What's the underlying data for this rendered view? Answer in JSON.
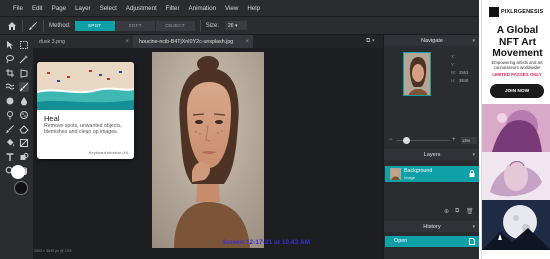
{
  "menubar": {
    "items": [
      "File",
      "Edit",
      "Page",
      "Layer",
      "Select",
      "Adjustment",
      "Filter",
      "Animation",
      "View",
      "Help"
    ]
  },
  "options": {
    "method_label": "Method:",
    "methods": [
      "SPOT",
      "SOFT",
      "OBJECT"
    ],
    "active_method": "SPOT",
    "size_label": "Size:",
    "size_value": "26 ▾"
  },
  "tabs": [
    {
      "label": "dusk 3.png"
    },
    {
      "label": "houcine-ncib-B4TjXnI0Y2c-unsplash.jpg"
    }
  ],
  "tooltip": {
    "title": "Heal",
    "description": "Remove spots, unwanted objects, blemishes and clean up images.",
    "shortcut": "Keyboard shortcut (H)"
  },
  "canvas": {
    "status": "2553 × 3840 px @ 13%",
    "watermark": "Screen 12-17-21 at 10.43 AM"
  },
  "navigate": {
    "title": "Navigate",
    "meta_labels": [
      "X:",
      "Y:",
      "W:",
      "H:"
    ],
    "meta_values": [
      "",
      "",
      "2553",
      "3840"
    ],
    "zoom": "13%",
    "zoom_fraction": 0.12
  },
  "layers": {
    "title": "Layers",
    "items": [
      {
        "name": "Background",
        "sub": "Image"
      }
    ]
  },
  "history": {
    "title": "History",
    "items": [
      {
        "name": "Open"
      }
    ]
  },
  "ad": {
    "brand": "PIXLRGENESIS",
    "headline": "A Global NFT Art Movement",
    "subtext": "Empowering artists and art connoisseurs worldwide!",
    "limited": "LIMITED PASSES ONLY",
    "cta": "JOIN NOW"
  },
  "colors": {
    "accent": "#0fa0a8",
    "panel": "#2b2c30",
    "canvas_bg": "#1d1e21",
    "watermark": "#3b2fd1"
  },
  "icons": [
    "home-icon",
    "brush-icon",
    "move-icon",
    "marquee-icon",
    "lasso-icon",
    "wand-icon",
    "crop-icon",
    "heal-icon",
    "eraser-icon",
    "fill-icon",
    "text-icon",
    "zoom-icon",
    "eyedropper-icon",
    "lock-icon"
  ]
}
